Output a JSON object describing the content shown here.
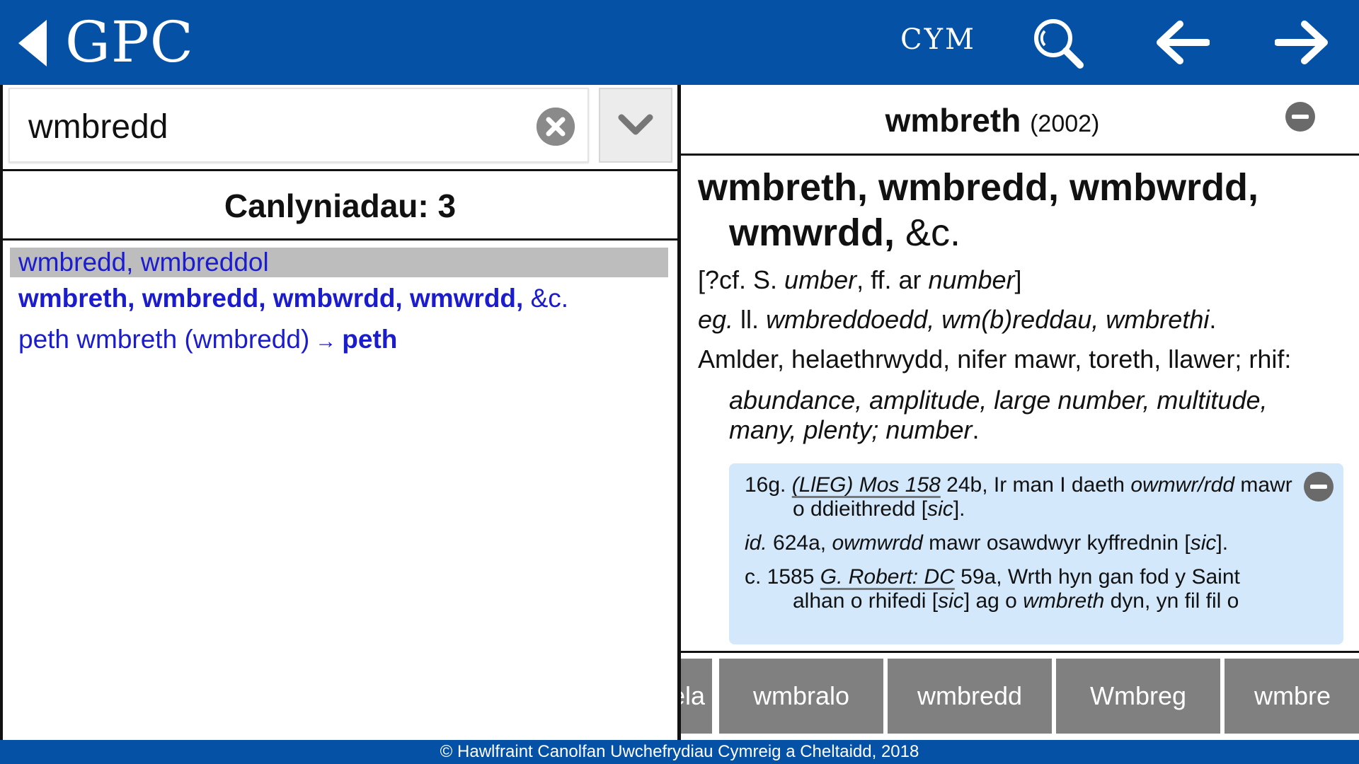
{
  "header": {
    "app_title": "GPC",
    "lang_label": "CYM",
    "back_icon": "chevron-left-icon",
    "search_icon": "search-icon",
    "prev_icon": "arrow-left-icon",
    "next_icon": "arrow-right-icon",
    "background_color": "#0451a5"
  },
  "search": {
    "value": "wmbredd",
    "placeholder": "",
    "clear_icon": "clear-circle-icon",
    "dropdown_icon": "chevron-down-icon"
  },
  "results": {
    "header": "Canlyniadau: 3",
    "items": [
      {
        "text": "wmbredd, wmbreddol",
        "selected": true
      },
      {
        "bold": "wmbreth, wmbredd, wmbwrdd, wmwrdd,",
        "rest": " &c."
      },
      {
        "text": "peth wmbreth (wmbredd)",
        "arrow": "→",
        "target": "peth"
      }
    ]
  },
  "entry": {
    "title_word": "wmbreth",
    "title_year": "(2002)",
    "headwords": "wmbreth, wmbredd, wmbwrdd, wmwrdd,",
    "headwords_tail": " &c.",
    "etymology": {
      "a": "[?cf. S. ",
      "b": "umber",
      "c": ", ff. ar ",
      "d": "number",
      "e": "]"
    },
    "grammar": {
      "pos": "eg.",
      "plural_label": " ll. ",
      "plurals": "wmbreddoedd, wm(b)reddau, wmbrethi",
      "end": "."
    },
    "definition": "Amlder, helaethrwydd, nifer mawr, toreth, llawer; rhif:",
    "gloss": "abundance, amplitude, large number, multitude, many, plenty; number",
    "gloss_end": ".",
    "citations": [
      {
        "date": "16g. ",
        "source": "(LlEG) Mos 158",
        "t1": " 24b, Ir man I daeth ",
        "i1": "owmwr/rdd",
        "t2": " mawr o ddieithredd [",
        "i2": "sic",
        "t3": "]."
      },
      {
        "source": "id.",
        "t1": " 624a, ",
        "i1": "owmwrdd",
        "t2": " mawr osawdwyr kyffrednin [",
        "i2": "sic",
        "t3": "]."
      },
      {
        "date": "c. 1585 ",
        "source": "G. Robert: DC",
        "t1": " 59a, Wrth hyn gan fod y Saint alhan o rhifedi [",
        "i1": "sic",
        "t2": "] ag o ",
        "i2": "wmbreth",
        "t3": " dyn, yn fil fil o"
      }
    ]
  },
  "word_strip": [
    "ela",
    "wmbralo",
    "wmbredd",
    "Wmbreg",
    "wmbre"
  ],
  "footer": "© Hawlfraint Canolfan Uwchefrydiau Cymreig a Cheltaidd, 2018"
}
